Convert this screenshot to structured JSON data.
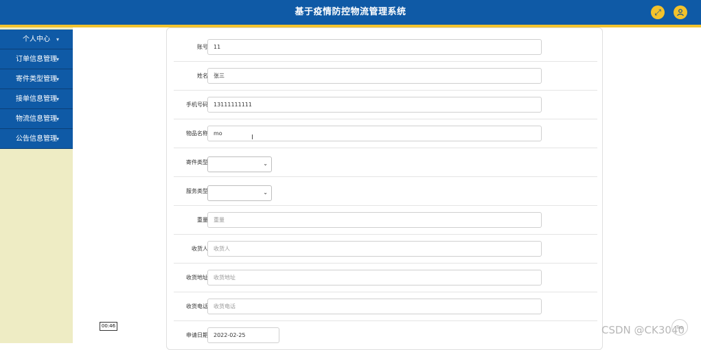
{
  "header": {
    "title": "基于疫情防控物流管理系统",
    "fullscreen_icon": "expand-icon",
    "user_icon": "user-icon",
    "colors": {
      "header": "#0f5aa6",
      "accent": "#f2c32e"
    }
  },
  "sidebar": {
    "items": [
      {
        "label": "个人中心"
      },
      {
        "label": "订单信息管理"
      },
      {
        "label": "寄件类型管理"
      },
      {
        "label": "接单信息管理"
      },
      {
        "label": "物流信息管理"
      },
      {
        "label": "公告信息管理"
      }
    ],
    "background": "#eeecc4"
  },
  "form": {
    "account": {
      "label": "账号",
      "value": "11"
    },
    "name": {
      "label": "姓名",
      "value": "张三"
    },
    "phone": {
      "label": "手机号码",
      "value": "13111111111"
    },
    "item_name": {
      "label": "物品名称",
      "value": "mo"
    },
    "send_type": {
      "label": "寄件类型",
      "value": ""
    },
    "service_type": {
      "label": "服务类型",
      "value": ""
    },
    "weight": {
      "label": "重量",
      "placeholder": "重量"
    },
    "receiver": {
      "label": "收货人",
      "placeholder": "收货人"
    },
    "address": {
      "label": "收货地址",
      "placeholder": "收货地址"
    },
    "receiver_phone": {
      "label": "收货电话",
      "placeholder": "收货电话"
    },
    "apply_date": {
      "label": "申请日期",
      "value": "2022-02-25"
    }
  },
  "overlay": {
    "timer": "00:46",
    "watermark": "CSDN @CK3040",
    "top_label": "Top"
  }
}
